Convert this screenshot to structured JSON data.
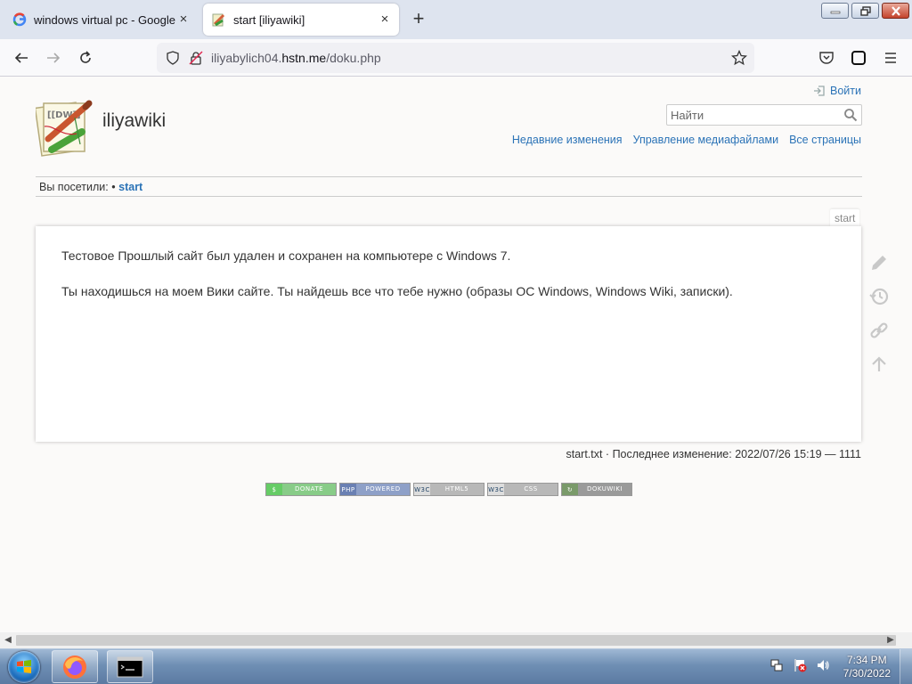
{
  "browser": {
    "tabs": [
      {
        "label": "windows virtual pc - Google Search",
        "close": "×"
      },
      {
        "label": "start [iliyawiki]",
        "close": "×"
      }
    ],
    "new_tab": "+",
    "url": {
      "prefix": "iliyabylich04.",
      "host": "hstn.me",
      "path": "/doku.php"
    }
  },
  "wiki": {
    "login": "Войти",
    "title": "iliyawiki",
    "search_placeholder": "Найти",
    "nav": [
      "Недавние изменения",
      "Управление медиафайлами",
      "Все страницы"
    ],
    "breadcrumbs_label": "Вы посетили:",
    "breadcrumbs_sep": "•",
    "breadcrumbs_item": "start",
    "page_tag": "start",
    "paragraphs": [
      "Тестовое Прошлый сайт был удален и сохранен на компьютере с Windows 7.",
      "Ты находишься на моем Вики сайте. Ты найдешь все что тебе нужно (образы ОС Windows, Windows Wiki, записки)."
    ],
    "doc_info": "start.txt · Последнее изменение: 2022/07/26 15:19 — 1111",
    "badges": [
      "DONATE",
      "POWERED",
      "HTML5",
      "CSS",
      "DOKUWIKI"
    ],
    "badge_icons": [
      "$",
      "PHP",
      "W3C",
      "W3C",
      "↻"
    ]
  },
  "taskbar": {
    "time": "7:34 PM",
    "date": "7/30/2022"
  },
  "colors": {
    "link": "#2b73b7",
    "tab_strip": "#dee4ef",
    "taskbar": "#6f8fb4"
  }
}
